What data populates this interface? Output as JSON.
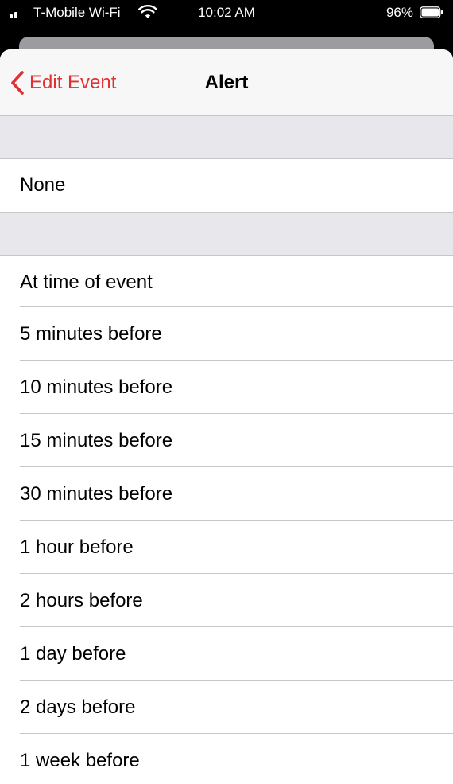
{
  "status_bar": {
    "carrier": "T-Mobile Wi-Fi",
    "time": "10:02 AM",
    "battery": "96%"
  },
  "nav": {
    "back_label": "Edit Event",
    "title": "Alert"
  },
  "none_option": "None",
  "alert_options": [
    "At time of event",
    "5 minutes before",
    "10 minutes before",
    "15 minutes before",
    "30 minutes before",
    "1 hour before",
    "2 hours before",
    "1 day before",
    "2 days before",
    "1 week before"
  ],
  "colors": {
    "accent": "#e03030",
    "nav_background": "#f7f7f7",
    "group_background": "#e7e7ec",
    "separator": "#c6c6c8"
  },
  "icons": {
    "signal": "cellular-signal-icon",
    "wifi": "wifi-icon",
    "battery": "battery-icon",
    "back": "chevron-left-icon"
  }
}
